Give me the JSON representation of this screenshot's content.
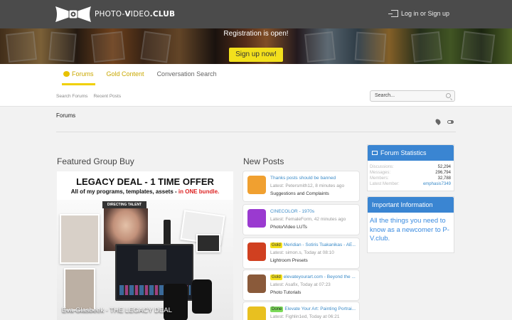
{
  "header": {
    "logo_text_a": "PHOTO-",
    "logo_text_b": "V",
    "logo_text_c": "IDEO",
    "logo_text_d": ".CLUB",
    "login_label": "Log in or Sign up"
  },
  "banner": {
    "registration_text": "Registration is open!",
    "signup_label": "Sign up now!"
  },
  "nav": {
    "tabs": [
      {
        "label": "Forums",
        "active": true
      },
      {
        "label": "Gold Content"
      },
      {
        "label": "Conversation Search"
      }
    ],
    "sub_links": [
      "Search Forums",
      "Recent Posts"
    ],
    "search_placeholder": "Search..."
  },
  "breadcrumb": {
    "root": "Forums"
  },
  "featured": {
    "heading": "Featured Group Buy",
    "image_title": "LEGACY DEAL - 1 TIME OFFER",
    "image_sub_a": "All of my programs, templates, assets - ",
    "image_sub_b": "in ONE bundle.",
    "image_tag": "DIRECTING TALENT",
    "caption": "Eva Glasbeek - THE LEGACY DEAL"
  },
  "new_posts": {
    "heading": "New Posts",
    "items": [
      {
        "prefix": "",
        "title": "Thanks posts should be banned",
        "latest": "Latest: Petersmith12, 8 minutes ago",
        "forum": "Suggestions and Complaints",
        "avatar_color": "#f0a030"
      },
      {
        "prefix": "",
        "title": "CINECOLOR - 1970s",
        "latest": "Latest: FemaleForm, 42 minutes ago",
        "forum": "Photo/Video LUTs",
        "avatar_color": "#9a3ad0"
      },
      {
        "prefix": "Gold",
        "title": "Meridian - Sotiris Tsakanikas - AE...",
        "latest": "Latest: simon.s, Today at 08:10",
        "forum": "Lightroom Presets",
        "avatar_color": "#d04020"
      },
      {
        "prefix": "Gold",
        "title": "elevateyourart.com - Beyond the ...",
        "latest": "Latest: Asafix, Today at 07:23",
        "forum": "Photo Tutorials",
        "avatar_color": "#8a5a3a"
      },
      {
        "prefix": "Done",
        "title": "Elevate Your Art: Painting Portrai...",
        "latest": "Latest: Fighlin1ed, Today at 06:21",
        "forum": "",
        "avatar_color": "#e8c020"
      }
    ]
  },
  "sidebar": {
    "stats_title": "Forum Statistics",
    "stats": [
      {
        "label": "Discussions:",
        "value": "52,294"
      },
      {
        "label": "Messages:",
        "value": "296,794"
      },
      {
        "label": "Members:",
        "value": "32,788"
      },
      {
        "label": "Latest Member:",
        "value": "emphasis7349"
      }
    ],
    "info_title": "Important Information",
    "info_text": "All the things you need to know as a newcomer to P-V.club."
  },
  "colors": {
    "accent": "#f3e01c",
    "link": "#3b8bc8",
    "sidebar_head": "#3a85d2",
    "header_bg": "#4b4b4b"
  }
}
